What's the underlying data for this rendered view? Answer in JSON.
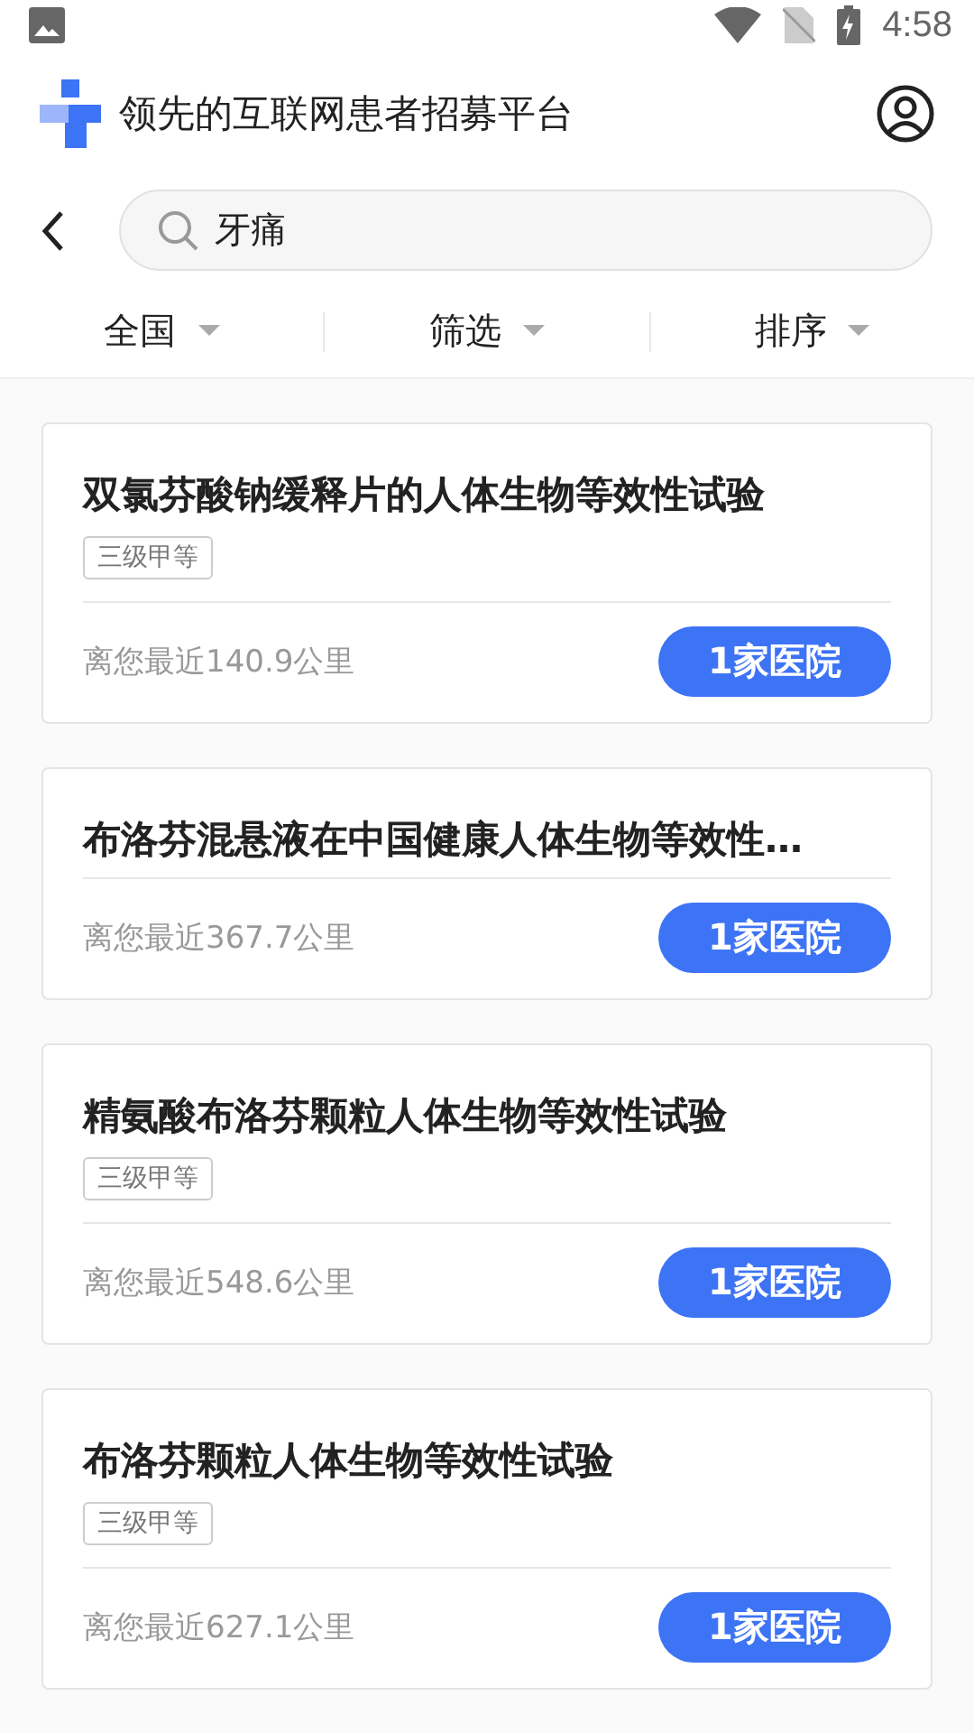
{
  "status_bar": {
    "time": "4:58"
  },
  "header": {
    "title": "领先的互联网患者招募平台"
  },
  "search": {
    "value": "牙痛"
  },
  "filters": [
    {
      "label": "全国"
    },
    {
      "label": "筛选"
    },
    {
      "label": "排序"
    }
  ],
  "cards": [
    {
      "title": "双氯芬酸钠缓释片的人体生物等效性试验",
      "tags": [
        "三级甲等"
      ],
      "distance": "离您最近140.9公里",
      "button": "1家医院"
    },
    {
      "title": "布洛芬混悬液在中国健康人体生物等效性…",
      "distance": "离您最近367.7公里",
      "button": "1家医院"
    },
    {
      "title": "精氨酸布洛芬颗粒人体生物等效性试验",
      "tags": [
        "三级甲等"
      ],
      "distance": "离您最近548.6公里",
      "button": "1家医院"
    },
    {
      "title": "布洛芬颗粒人体生物等效性试验",
      "tags": [
        "三级甲等"
      ],
      "distance": "离您最近627.1公里",
      "button": "1家医院"
    }
  ]
}
